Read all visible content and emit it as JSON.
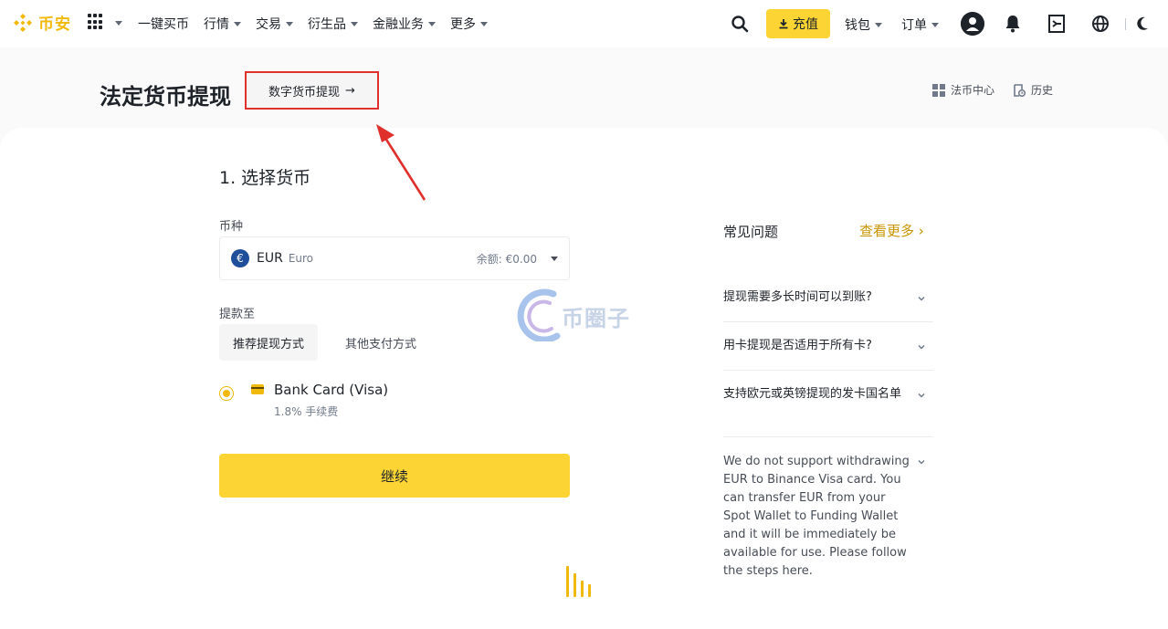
{
  "nav": {
    "logo_text": "币安",
    "items": [
      {
        "label": "一键买币",
        "has_caret": false
      },
      {
        "label": "行情",
        "has_caret": true
      },
      {
        "label": "交易",
        "has_caret": true
      },
      {
        "label": "衍生品",
        "has_caret": true
      },
      {
        "label": "金融业务",
        "has_caret": true
      },
      {
        "label": "更多",
        "has_caret": true
      }
    ],
    "deposit_label": "充值",
    "wallet_label": "钱包",
    "orders_label": "订单"
  },
  "header": {
    "title": "法定货币提现",
    "crypto_withdraw_label": "数字货币提现",
    "crypto_withdraw_arrow": "→",
    "fiat_center_label": "法币中心",
    "history_label": "历史"
  },
  "form": {
    "step_title": "1. 选择货币",
    "currency_label": "币种",
    "currency_symbol": "€",
    "currency_code": "EUR",
    "currency_name": "Euro",
    "balance_text": "余额: €0.00",
    "withdraw_to_label": "提款至",
    "tab_recommended": "推荐提现方式",
    "tab_other": "其他支付方式",
    "method_name": "Bank Card (Visa)",
    "method_fee": "1.8% 手续费",
    "continue_label": "继续"
  },
  "watermark": {
    "text": "币圈子"
  },
  "faq": {
    "title": "常见问题",
    "more_label": "查看更多 ›",
    "items": [
      "提现需要多长时间可以到账?",
      "用卡提现是否适用于所有卡?",
      "支持欧元或英镑提现的发卡国名单"
    ],
    "note": "We do not support withdrawing EUR to Binance Visa card. You can transfer EUR from your Spot Wallet to Funding Wallet and it will be immediately be available for use. Please follow the steps here."
  },
  "colors": {
    "brand_yellow": "#fcd535",
    "brand_gold": "#f0b90b",
    "annotation_red": "#e0302c",
    "link_gold": "#c99400"
  }
}
